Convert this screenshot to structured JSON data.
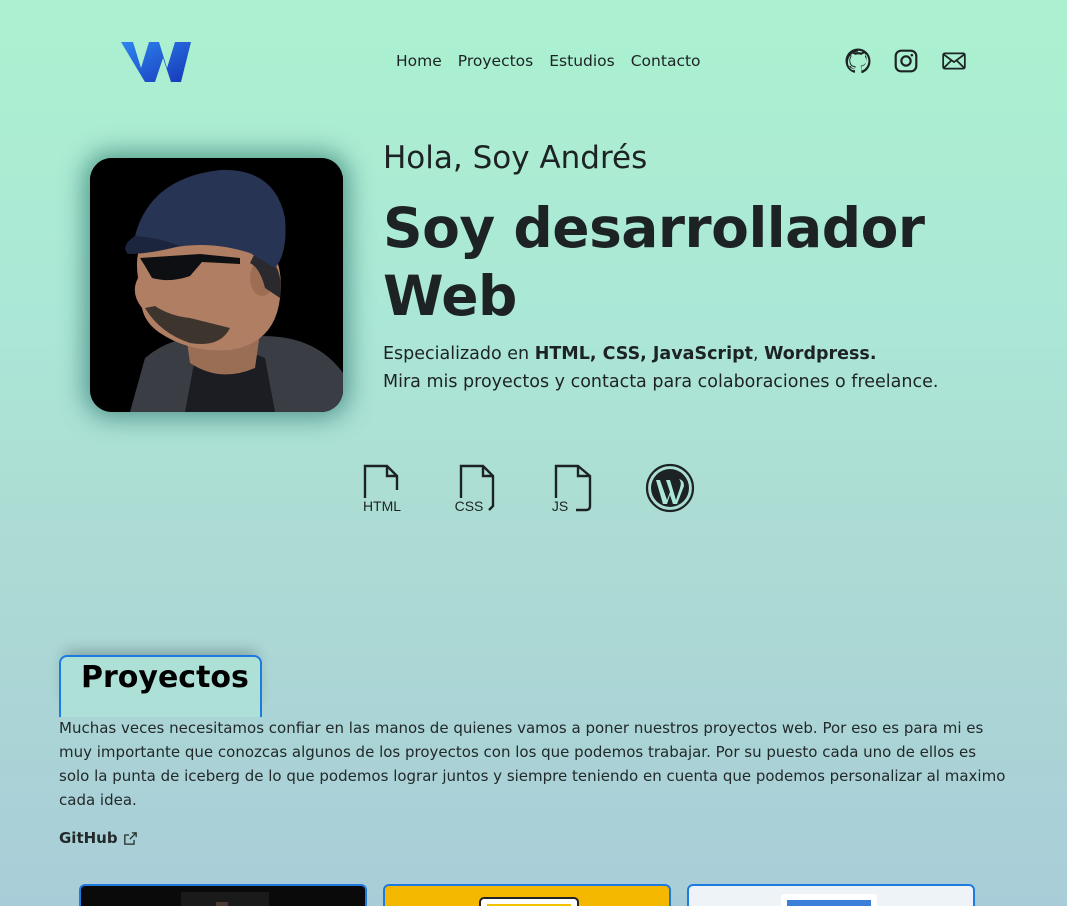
{
  "header": {
    "logo_icon": "wy-logo",
    "nav": [
      "Home",
      "Proyectos",
      "Estudios",
      "Contacto"
    ],
    "social": [
      "github-icon",
      "instagram-icon",
      "mail-icon"
    ]
  },
  "hero": {
    "greeting": "Hola, Soy Andrés",
    "role_line1": "Soy desarrollador",
    "role_line2": "Web",
    "desc_prefix": "Especializado en ",
    "desc_skills": "HTML, CSS, JavaScript",
    "desc_comma": ", ",
    "desc_wp": "Wordpress.",
    "desc_line2": "Mira mis proyectos y contacta para colaboraciones o freelance.",
    "skills": [
      {
        "icon": "html-file-icon",
        "label": "HTML"
      },
      {
        "icon": "css-file-icon",
        "label": "CSS"
      },
      {
        "icon": "js-file-icon",
        "label": "JS"
      },
      {
        "icon": "wordpress-icon",
        "label": ""
      }
    ]
  },
  "projects": {
    "title": "Proyectos",
    "text": "Muchas veces necesitamos confiar en las manos de quienes vamos a poner nuestros proyectos web. Por eso es para mi es muy importante que conozcas algunos de los proyectos con los que podemos trabajar. Por su puesto cada uno de ellos es solo la punta de iceberg de lo que podemos lograr juntos y siempre teniendo en cuenta que podemos personalizar al maximo cada idea.",
    "github_label": "GitHub"
  },
  "colors": {
    "accent": "#1f7ae0",
    "logo_blue": "#1e55d8",
    "text": "#1d2324"
  }
}
